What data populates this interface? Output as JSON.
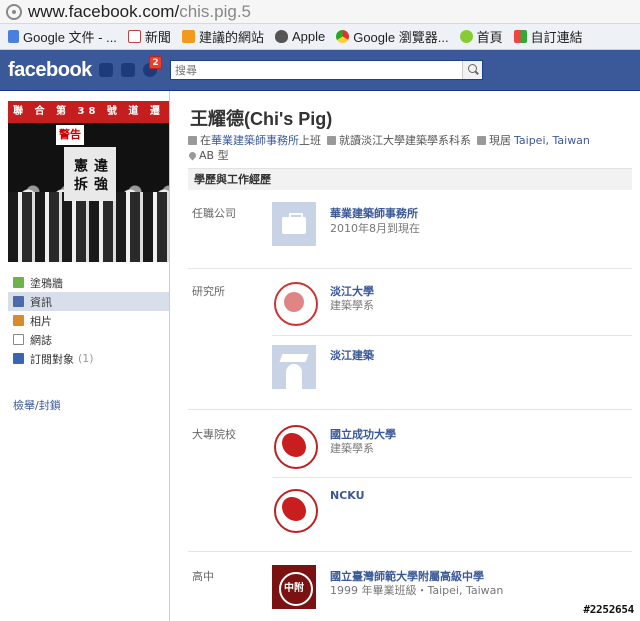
{
  "browser": {
    "url_host": "www.facebook.com/",
    "url_path": "chis.pig.5",
    "bookmarks": [
      {
        "label": "Google 文件 - ...",
        "icon": "doc-icon"
      },
      {
        "label": "新聞",
        "icon": "news-icon"
      },
      {
        "label": "建議的網站",
        "icon": "suggest-icon"
      },
      {
        "label": "Apple",
        "icon": "apple-icon"
      },
      {
        "label": "Google 瀏覽器...",
        "icon": "chrome-icon"
      },
      {
        "label": "首頁",
        "icon": "home-icon"
      },
      {
        "label": "自訂連結",
        "icon": "windows-icon"
      }
    ]
  },
  "fb": {
    "logo": "facebook",
    "notification_count": "2",
    "search_placeholder": "搜尋",
    "brand_color": "#3b5998"
  },
  "sidebar": {
    "profile_pic_banner": "聯 合 第 38 號 道 遷",
    "profile_pic_sign1": "警告",
    "profile_pic_sign2": "違 強 憲 拆",
    "items": [
      {
        "label": "塗鴉牆",
        "icon": "wall-icon",
        "active": false
      },
      {
        "label": "資訊",
        "icon": "info-icon",
        "active": true
      },
      {
        "label": "相片",
        "icon": "photos-icon",
        "active": false
      },
      {
        "label": "網誌",
        "icon": "notes-icon",
        "active": false
      },
      {
        "label": "訂閱對象",
        "count": "(1)",
        "icon": "subscriptions-icon",
        "active": false
      }
    ],
    "report_link": "檢舉/封鎖"
  },
  "profile": {
    "name": "王耀德(Chi's Pig)",
    "work_prefix": "在",
    "work_place": "華業建築師事務所",
    "work_suffix": "上班",
    "study_prefix": "就讀",
    "study_place": "淡江大學建築學系科系",
    "lives_prefix": "現居",
    "lives_place": "Taipei, Taiwan",
    "blood_type": "AB 型"
  },
  "education_work": {
    "section_title": "學歷與工作經歷",
    "groups": {
      "employer": {
        "label": "任職公司",
        "entries": [
          {
            "title": "華業建築師事務所",
            "sub": "2010年8月到現在"
          }
        ]
      },
      "grad_school": {
        "label": "研究所",
        "entries": [
          {
            "title": "淡江大學",
            "sub": "建築學系"
          },
          {
            "title": "淡江建築",
            "sub": ""
          }
        ]
      },
      "college": {
        "label": "大專院校",
        "entries": [
          {
            "title": "國立成功大學",
            "sub": "建築學系"
          },
          {
            "title": "NCKU",
            "sub": ""
          }
        ]
      },
      "high_school": {
        "label": "高中",
        "entries": [
          {
            "title": "國立臺灣師範大學附屬高級中學",
            "sub": "1999 年畢業班級・Taipei, Taiwan",
            "logo_text": "中附"
          }
        ]
      }
    }
  },
  "watermark": "#2252654"
}
